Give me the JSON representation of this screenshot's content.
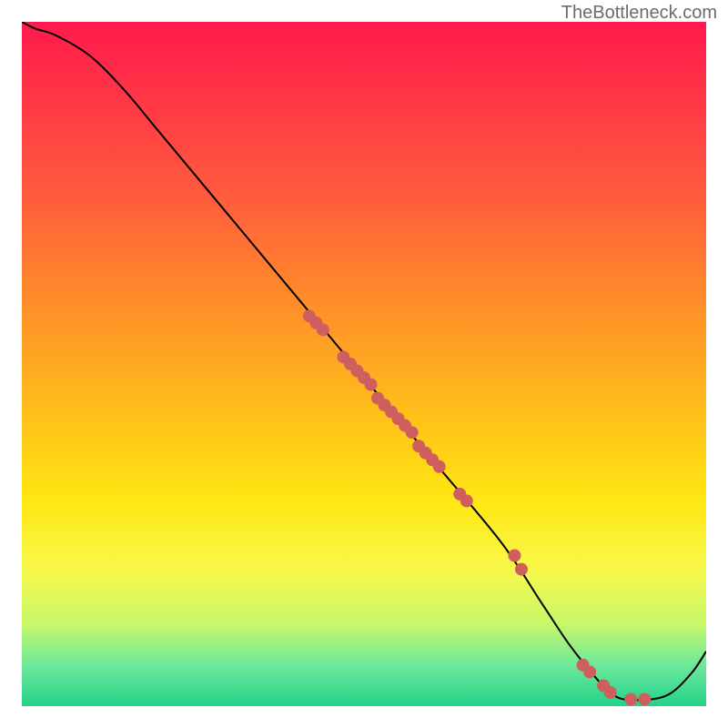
{
  "watermark": "TheBottleneck.com",
  "colors": {
    "gradient_top": "#ff1a4d",
    "gradient_bottom": "#22d28a",
    "curve": "#000000",
    "dot": "#cf5f5f"
  },
  "chart_data": {
    "type": "line",
    "title": "",
    "xlabel": "",
    "ylabel": "",
    "xlim": [
      0,
      100
    ],
    "ylim": [
      0,
      100
    ],
    "grid": false,
    "axes_visible": false,
    "legend": false,
    "series": [
      {
        "name": "curve",
        "x": [
          0,
          2,
          5,
          10,
          15,
          20,
          30,
          40,
          50,
          60,
          70,
          76,
          80,
          84,
          86,
          88,
          92,
          95,
          98,
          100
        ],
        "y": [
          100,
          99,
          98,
          95,
          90,
          84,
          72,
          60,
          48,
          36,
          24,
          15,
          9,
          4,
          2,
          1,
          1,
          2,
          5,
          8
        ]
      }
    ],
    "points": [
      {
        "x": 42,
        "y": 57
      },
      {
        "x": 43,
        "y": 56
      },
      {
        "x": 44,
        "y": 55
      },
      {
        "x": 47,
        "y": 51
      },
      {
        "x": 48,
        "y": 50
      },
      {
        "x": 49,
        "y": 49
      },
      {
        "x": 50,
        "y": 48
      },
      {
        "x": 51,
        "y": 47
      },
      {
        "x": 52,
        "y": 45
      },
      {
        "x": 53,
        "y": 44
      },
      {
        "x": 54,
        "y": 43
      },
      {
        "x": 55,
        "y": 42
      },
      {
        "x": 56,
        "y": 41
      },
      {
        "x": 57,
        "y": 40
      },
      {
        "x": 58,
        "y": 38
      },
      {
        "x": 59,
        "y": 37
      },
      {
        "x": 60,
        "y": 36
      },
      {
        "x": 61,
        "y": 35
      },
      {
        "x": 64,
        "y": 31
      },
      {
        "x": 65,
        "y": 30
      },
      {
        "x": 72,
        "y": 22
      },
      {
        "x": 73,
        "y": 20
      },
      {
        "x": 82,
        "y": 6
      },
      {
        "x": 83,
        "y": 5
      },
      {
        "x": 85,
        "y": 3
      },
      {
        "x": 86,
        "y": 2
      },
      {
        "x": 89,
        "y": 1
      },
      {
        "x": 91,
        "y": 1
      }
    ]
  }
}
